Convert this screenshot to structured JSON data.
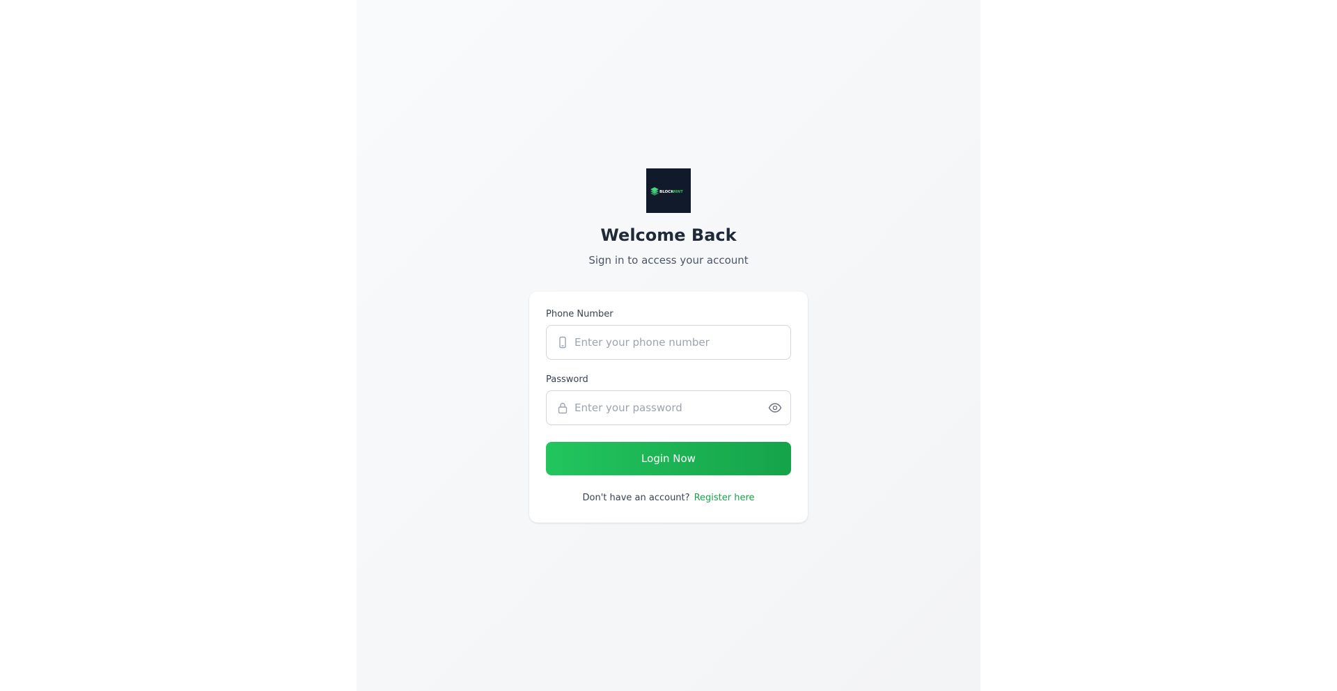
{
  "brand": {
    "logo_text_a": "BLOCK",
    "logo_text_b": "MINT",
    "logo_background": "#111a2b",
    "accent": "#22c55e"
  },
  "header": {
    "title": "Welcome Back",
    "subtitle": "Sign in to access your account"
  },
  "form": {
    "phone": {
      "label": "Phone Number",
      "placeholder": "Enter your phone number",
      "value": "",
      "icon": "phone-icon"
    },
    "password": {
      "label": "Password",
      "placeholder": "Enter your password",
      "value": "",
      "icon": "lock-icon",
      "toggle_icon": "eye-icon"
    },
    "submit_label": "Login Now",
    "register_prompt": "Don't have an account?",
    "register_link": "Register here"
  }
}
